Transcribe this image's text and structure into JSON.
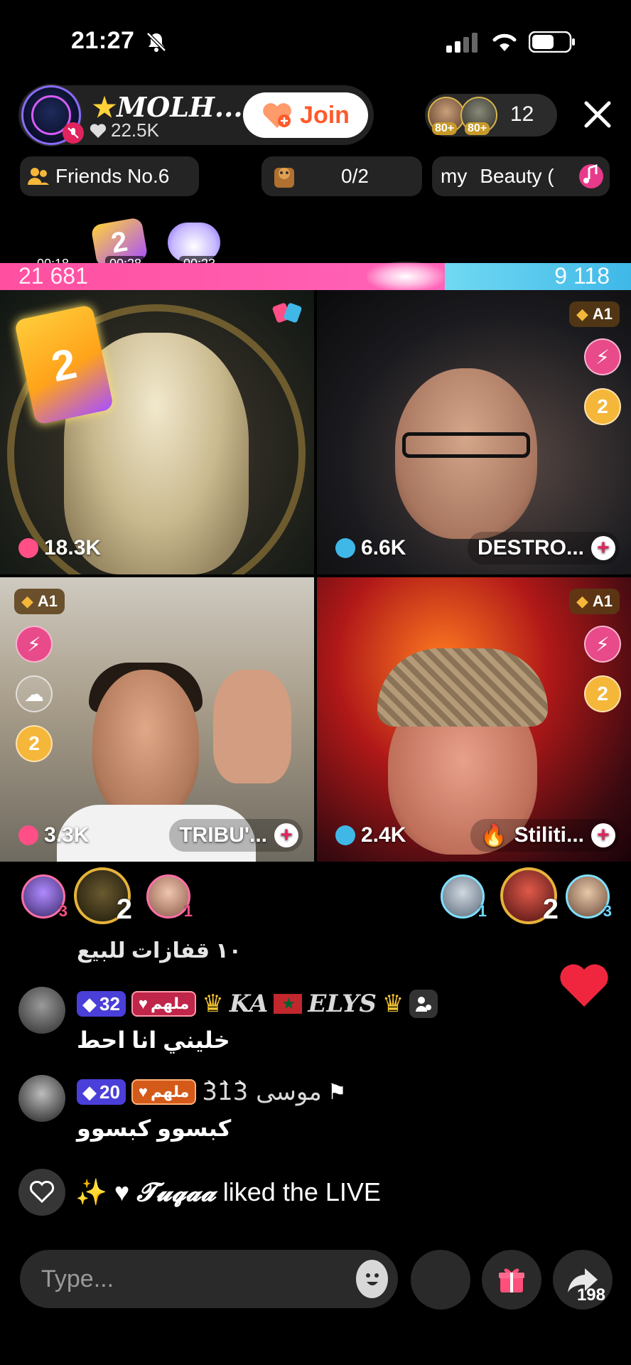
{
  "status": {
    "time": "21:27"
  },
  "host": {
    "name": "MOLH...",
    "star": "★",
    "likes": "22.5K",
    "join_label": "Join"
  },
  "viewers": {
    "badge_1": "80+",
    "badge_2": "80+",
    "count": "12"
  },
  "chips": {
    "friends": "Friends No.6",
    "progress": "0/2",
    "song_prefix": "my",
    "song": "Beauty ("
  },
  "battle": {
    "left_score": "21 681",
    "right_score": "9 118",
    "left_fraction": 0.705,
    "timers": [
      "00:18",
      "00:28",
      "00:23"
    ],
    "effect_label": "2"
  },
  "tiles": [
    {
      "score": "18.3K",
      "name": "",
      "multiplier": "2"
    },
    {
      "badge": "A1",
      "score": "6.6K",
      "name": "DESTRO...",
      "side_label": "2"
    },
    {
      "badge": "A1",
      "score": "3.3K",
      "name": "TRIBU'...",
      "side_label": "2"
    },
    {
      "badge": "A1",
      "score": "2.4K",
      "name": "Stiliti...",
      "side_label": "2"
    }
  ],
  "gifters": {
    "left": [
      {
        "rank": "3"
      },
      {
        "rank": "2"
      },
      {
        "rank": "1"
      }
    ],
    "right": [
      {
        "rank": "1"
      },
      {
        "rank": "2"
      },
      {
        "rank": "3"
      }
    ]
  },
  "chat": {
    "line_0": "١٠ قفازات للبيع",
    "messages": [
      {
        "level": "32",
        "fan_badge": "ملهم",
        "username_a": "KA",
        "username_b": "ELYS",
        "text": "خليني انا احط"
      },
      {
        "level": "20",
        "fan_badge": "ملهم",
        "username": "موسى 3̀1̀3̀",
        "text": "كبسوو كبسوو"
      }
    ],
    "liked": {
      "username": "𝓣𝓾𝓺𝓪𝓪",
      "suffix": "liked the LIVE"
    }
  },
  "bottom": {
    "input_placeholder": "Type...",
    "share_count": "198"
  },
  "colors": {
    "join": "#ff5a2a",
    "battle_left": "#ff4fa0",
    "battle_right": "#3fb8e8",
    "fan_badge": "#c0254a",
    "level_badge": "#4a3fd8"
  }
}
